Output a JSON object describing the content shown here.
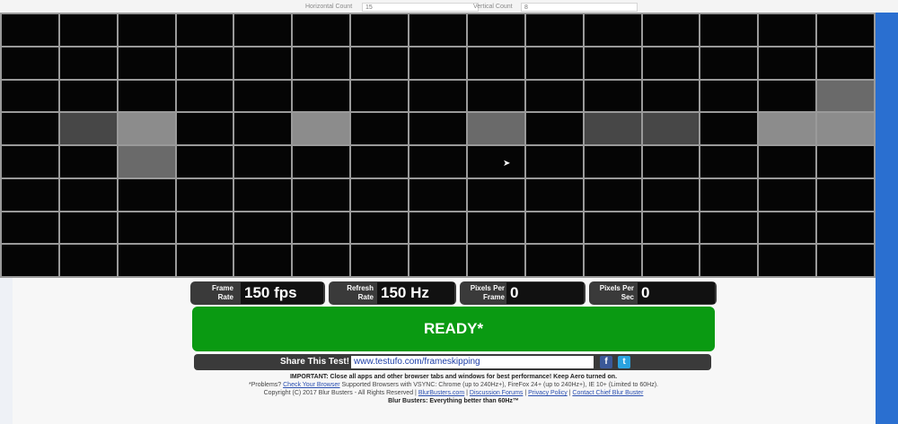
{
  "controls": {
    "horizontal_label": "Horizontal Count",
    "horizontal_value": "15",
    "vertical_label": "Vertical Count",
    "vertical_value": "8"
  },
  "grid": {
    "columns": 15,
    "rows": 8,
    "highlighted_cells": [
      {
        "row": 2,
        "col": 14,
        "shade": "g2"
      },
      {
        "row": 3,
        "col": 1,
        "shade": "g1"
      },
      {
        "row": 3,
        "col": 2,
        "shade": "g3"
      },
      {
        "row": 3,
        "col": 5,
        "shade": "g3"
      },
      {
        "row": 3,
        "col": 8,
        "shade": "g2"
      },
      {
        "row": 3,
        "col": 10,
        "shade": "g1"
      },
      {
        "row": 3,
        "col": 11,
        "shade": "g1"
      },
      {
        "row": 3,
        "col": 13,
        "shade": "g3"
      },
      {
        "row": 3,
        "col": 14,
        "shade": "g3"
      },
      {
        "row": 4,
        "col": 2,
        "shade": "g2"
      }
    ]
  },
  "stats": {
    "frame_rate_label": "Frame Rate",
    "frame_rate_value": "150 fps",
    "refresh_rate_label": "Refresh Rate",
    "refresh_rate_value": "150 Hz",
    "pixels_per_frame_label": "Pixels Per Frame",
    "pixels_per_frame_value": "0",
    "pixels_per_sec_label": "Pixels Per Sec",
    "pixels_per_sec_value": "0"
  },
  "status": {
    "text": "READY*"
  },
  "share": {
    "label": "Share This Test!",
    "url": "www.testufo.com/frameskipping",
    "facebook_glyph": "f",
    "twitter_glyph": "t"
  },
  "footer": {
    "important": "IMPORTANT: Close all apps and other browser tabs and windows for best performance! Keep Aero turned on.",
    "problems_prefix": "*Problems?",
    "check_browser_link": "Check Your Browser",
    "browsers_text": "Supported Browsers with VSYNC: Chrome (up to 240Hz+), FireFox 24+ (up to 240Hz+), IE 10+ (Limited to 60Hz).",
    "copyright": "Copyright (C) 2017 Blur Busters - All Rights Reserved |",
    "link_blurbusters": "BlurBusters.com",
    "link_forums": "Discussion Forums",
    "link_privacy": "Privacy Policy",
    "link_contact": "Contact Chief Blur Buster",
    "tagline": "Blur Busters: Everything better than 60Hz™"
  },
  "colors": {
    "ready_green": "#0a9a12",
    "panel_dark": "#3a3a3a",
    "grid_line": "#9a9a9a"
  }
}
